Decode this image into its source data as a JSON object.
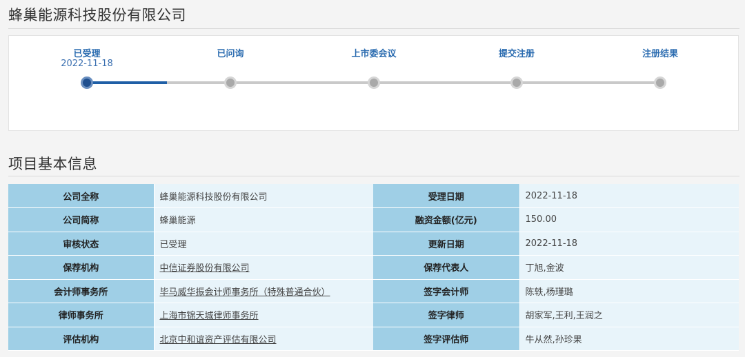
{
  "company_title": "蜂巢能源科技股份有限公司",
  "progress": {
    "steps": [
      {
        "label": "已受理",
        "date": "2022-11-18",
        "done": true
      },
      {
        "label": "已问询",
        "date": "",
        "done": false
      },
      {
        "label": "上市委会议",
        "date": "",
        "done": false
      },
      {
        "label": "提交注册",
        "date": "",
        "done": false
      },
      {
        "label": "注册结果",
        "date": "",
        "done": false
      }
    ],
    "completed_fraction": 0.14
  },
  "section_title": "项目基本信息",
  "info_rows": [
    {
      "k1": "公司全称",
      "v1": "蜂巢能源科技股份有限公司",
      "k2": "受理日期",
      "v2": "2022-11-18"
    },
    {
      "k1": "公司简称",
      "v1": "蜂巢能源",
      "k2": "融资金额(亿元)",
      "v2": "150.00"
    },
    {
      "k1": "审核状态",
      "v1": "已受理",
      "k2": "更新日期",
      "v2": "2022-11-18"
    },
    {
      "k1": "保荐机构",
      "v1": "中信证券股份有限公司",
      "k2": "保荐代表人",
      "v2": "丁旭,金波"
    },
    {
      "k1": "会计师事务所",
      "v1": "毕马威华振会计师事务所（特殊普通合伙）",
      "k2": "签字会计师",
      "v2": "陈轶,杨瑾璐"
    },
    {
      "k1": "律师事务所",
      "v1": "上海市锦天城律师事务所",
      "k2": "签字律师",
      "v2": "胡家军,王利,王润之"
    },
    {
      "k1": "评估机构",
      "v1": "北京中和谊资产评估有限公司",
      "k2": "签字评估师",
      "v2": "牛从然,孙珍果"
    }
  ],
  "colors": {
    "accent": "#1f5fa6",
    "key_cell": "#9fcfe6",
    "value_cell": "#e8f4fa",
    "step_label": "#2b6cb0"
  }
}
